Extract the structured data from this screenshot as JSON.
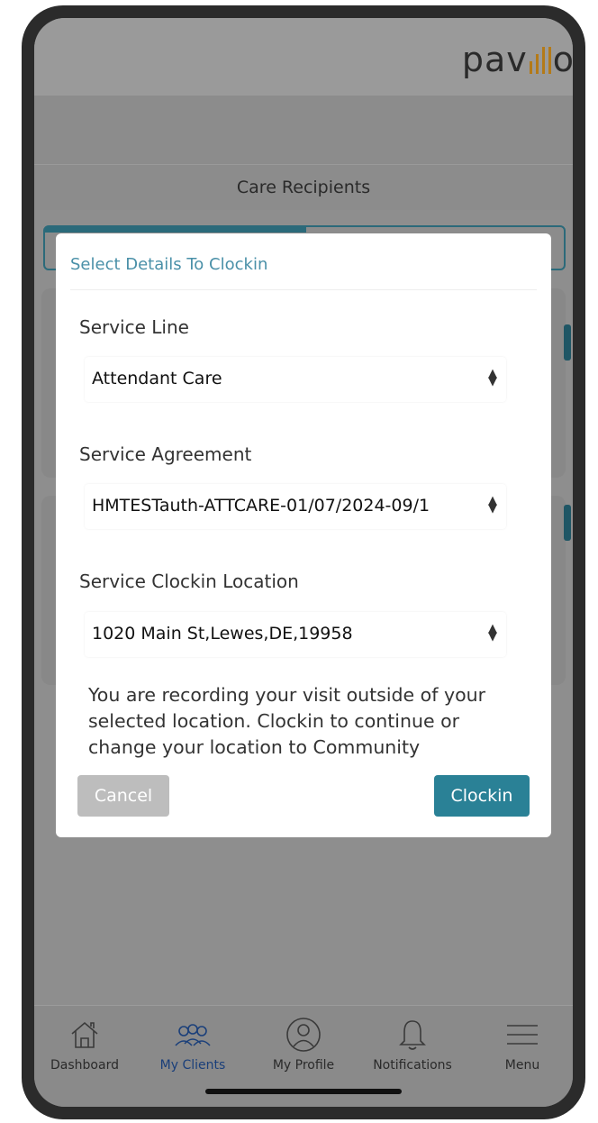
{
  "app": {
    "logo_text": "pav",
    "logo_tail": "o"
  },
  "header": {
    "title": "Care Recipients"
  },
  "modal": {
    "title": "Select Details To Clockin",
    "service_line": {
      "label": "Service Line",
      "value": "Attendant Care"
    },
    "service_agreement": {
      "label": "Service Agreement",
      "value": "HMTESTauth-ATTCARE-01/07/2024-09/1"
    },
    "clockin_location": {
      "label": "Service Clockin Location",
      "value": "1020 Main St,Lewes,DE,19958"
    },
    "warning": "You are recording your visit outside of your selected location. Clockin to continue or change your location to Community",
    "cancel_label": "Cancel",
    "clockin_label": "Clockin"
  },
  "nav": {
    "items": [
      {
        "label": "Dashboard",
        "icon": "home-icon"
      },
      {
        "label": "My Clients",
        "icon": "clients-icon",
        "active": true
      },
      {
        "label": "My Profile",
        "icon": "profile-icon"
      },
      {
        "label": "Notifications",
        "icon": "bell-icon"
      },
      {
        "label": "Menu",
        "icon": "hamburger-icon"
      }
    ]
  },
  "colors": {
    "accent": "#2a8196",
    "title_blue": "#4a90a8",
    "logo_gold": "#b47a18"
  }
}
